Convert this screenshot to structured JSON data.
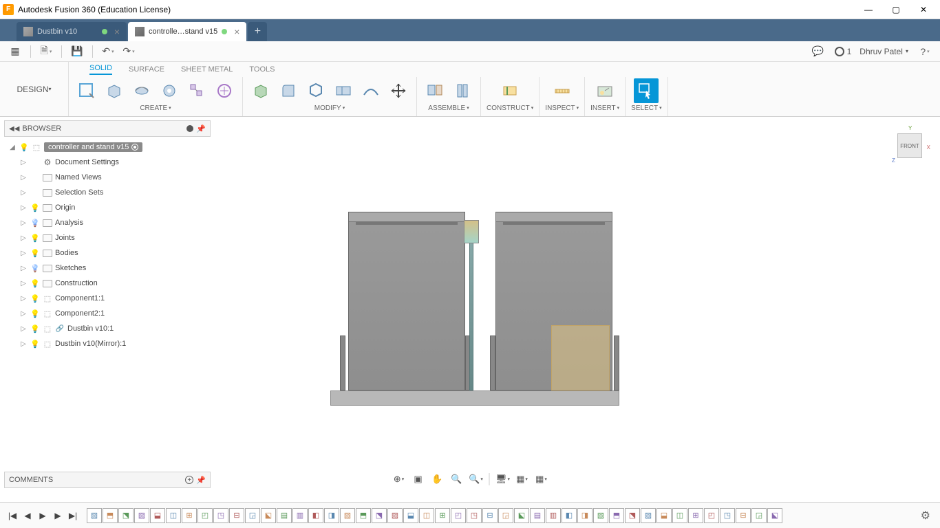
{
  "titlebar": {
    "title": "Autodesk Fusion 360 (Education License)"
  },
  "tabs": {
    "inactive": "Dustbin v10",
    "active": "controlle…stand v15"
  },
  "qat": {
    "user": "Dhruv Patel",
    "jobs": "1"
  },
  "workspace": "DESIGN",
  "ribbon_tabs": [
    "SOLID",
    "SURFACE",
    "SHEET METAL",
    "TOOLS"
  ],
  "panels": {
    "create": "CREATE",
    "modify": "MODIFY",
    "assemble": "ASSEMBLE",
    "construct": "CONSTRUCT",
    "inspect": "INSPECT",
    "insert": "INSERT",
    "select": "SELECT"
  },
  "browser": {
    "title": "BROWSER",
    "root": "controller and stand v15",
    "nodes": [
      {
        "label": "Document Settings",
        "icon": "gear"
      },
      {
        "label": "Named Views",
        "icon": "fld"
      },
      {
        "label": "Selection Sets",
        "icon": "fld"
      },
      {
        "label": "Origin",
        "icon": "fld",
        "bulb": "on"
      },
      {
        "label": "Analysis",
        "icon": "fld",
        "bulb": "blue"
      },
      {
        "label": "Joints",
        "icon": "fld",
        "bulb": "on"
      },
      {
        "label": "Bodies",
        "icon": "fld",
        "bulb": "on"
      },
      {
        "label": "Sketches",
        "icon": "fld",
        "bulb": "blue"
      },
      {
        "label": "Construction",
        "icon": "fld",
        "bulb": "on"
      },
      {
        "label": "Component1:1",
        "icon": "cube3",
        "bulb": "on"
      },
      {
        "label": "Component2:1",
        "icon": "cube3",
        "bulb": "on"
      },
      {
        "label": "Dustbin v10:1",
        "icon": "cube3",
        "bulb": "on",
        "link": true
      },
      {
        "label": "Dustbin v10(Mirror):1",
        "icon": "cube3",
        "bulb": "on"
      }
    ]
  },
  "viewcube": "FRONT",
  "comments": "COMMENTS",
  "timeline_count": 44
}
